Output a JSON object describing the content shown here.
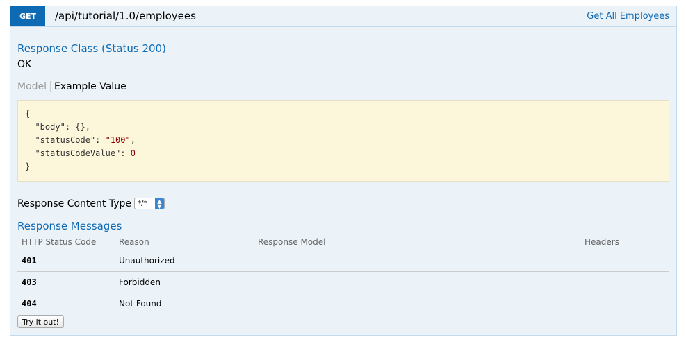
{
  "operation": {
    "method": "GET",
    "path": "/api/tutorial/1.0/employees",
    "summary": "Get All Employees"
  },
  "response_class": {
    "heading": "Response Class (Status 200)",
    "description": "OK"
  },
  "signature_tabs": {
    "model_label": "Model",
    "example_label": "Example Value"
  },
  "example_json": {
    "open": "{",
    "close": "}",
    "lines": [
      {
        "key": "\"body\"",
        "value": "{}",
        "trail": ","
      },
      {
        "key": "\"statusCode\"",
        "value": "\"100\"",
        "trail": ","
      },
      {
        "key": "\"statusCodeValue\"",
        "value": "0",
        "trail": ""
      }
    ]
  },
  "content_type": {
    "label": "Response Content Type",
    "selected": "*/*"
  },
  "response_messages": {
    "heading": "Response Messages",
    "columns": [
      "HTTP Status Code",
      "Reason",
      "Response Model",
      "Headers"
    ],
    "rows": [
      {
        "code": "401",
        "reason": "Unauthorized",
        "model": "",
        "headers": ""
      },
      {
        "code": "403",
        "reason": "Forbidden",
        "model": "",
        "headers": ""
      },
      {
        "code": "404",
        "reason": "Not Found",
        "model": "",
        "headers": ""
      }
    ]
  },
  "try_button_label": "Try it out!",
  "colors": {
    "get_method": "#0f6ab4",
    "panel_bg": "#ebf3f9",
    "snippet_bg": "#fcf6db"
  }
}
